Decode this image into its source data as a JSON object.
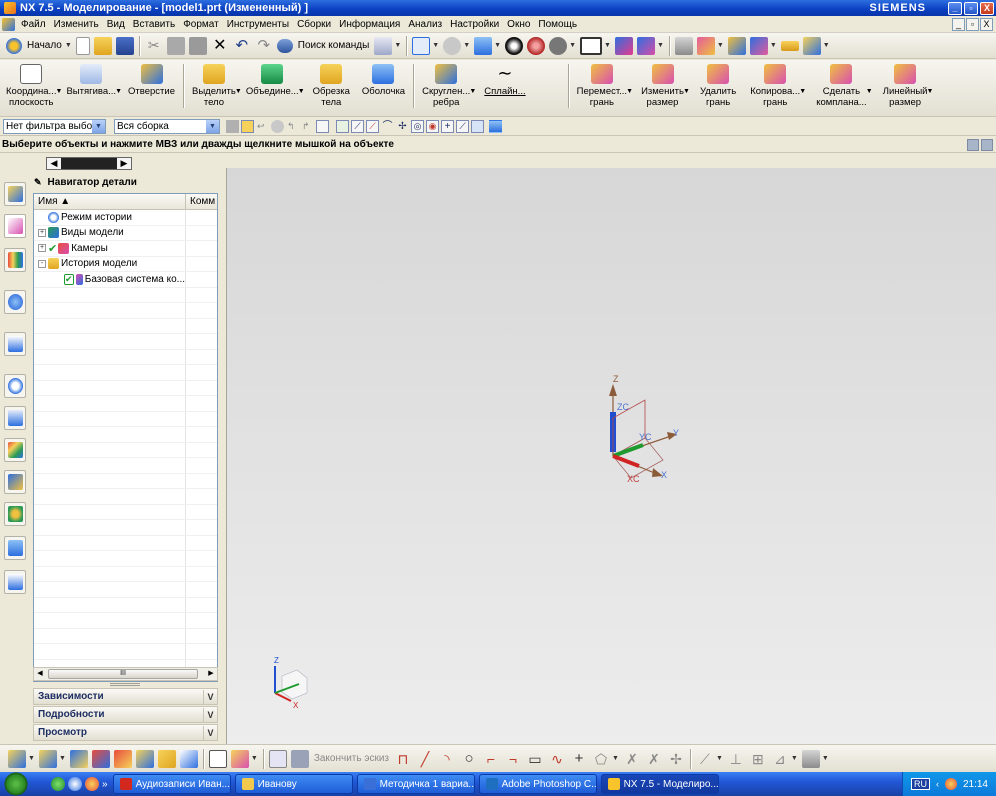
{
  "window": {
    "title": "NX 7.5 - Моделирование - [model1.prt (Измененный) ]",
    "brand": "SIEMENS",
    "controls": [
      "_",
      "▫",
      "X"
    ]
  },
  "menu": {
    "items": [
      "Файл",
      "Изменить",
      "Вид",
      "Вставить",
      "Формат",
      "Инструменты",
      "Сборки",
      "Информация",
      "Анализ",
      "Настройки",
      "Окно",
      "Помощь"
    ],
    "mdi_controls": [
      "_",
      "▫",
      "X"
    ]
  },
  "toolbar1": {
    "start_label": "Начало",
    "search_label": "Поиск команды"
  },
  "toolbar2": {
    "buttons": [
      {
        "label1": "Координа...",
        "label2": "плоскость",
        "color": "#E8E8E8"
      },
      {
        "label1": "Вытягива...",
        "label2": "",
        "color": "#C9D9F0"
      },
      {
        "label1": "Отверстие",
        "label2": "",
        "color": "#4D8FE0"
      },
      {
        "label1": "Выделить",
        "label2": "тело",
        "color": "#E8A53A"
      },
      {
        "label1": "Объедине...",
        "label2": "",
        "color": "#2C9A55"
      },
      {
        "label1": "Обрезка",
        "label2": "тела",
        "color": "#F0C040"
      },
      {
        "label1": "Оболочка",
        "label2": "",
        "color": "#4D8FE0"
      },
      {
        "label1": "Скруглен...",
        "label2": "ребра",
        "color": "#4D8FE0"
      },
      {
        "label1": "Сплайн...",
        "label2": "",
        "color": "#FFFFFF"
      },
      {
        "label1": "Перемест...",
        "label2": "грань",
        "color": "#D84FB0"
      },
      {
        "label1": "Изменить",
        "label2": "размер",
        "color": "#D84FB0"
      },
      {
        "label1": "Удалить",
        "label2": "грань",
        "color": "#D84FB0"
      },
      {
        "label1": "Копирова...",
        "label2": "грань",
        "color": "#D84FB0"
      },
      {
        "label1": "Сделать",
        "label2": "компланa...",
        "color": "#D84FB0"
      },
      {
        "label1": "Линейный",
        "label2": "размер",
        "color": "#D84FB0"
      }
    ]
  },
  "selection_bar": {
    "filter_value": "Нет фильтра выбо",
    "scope_value": "Вся сборка"
  },
  "cue_line": "Выберите объекты и нажмите МВЗ или дважды щелкните мышкой на объекте",
  "resource_bar": {
    "icons": [
      "assembly-navigator-icon",
      "part-navigator-icon",
      "reuse-library-icon",
      "help-icon",
      "web-icon",
      "history-icon",
      "system-materials-icon",
      "palette-icon",
      "process-studio-icon",
      "roles-icon",
      "system-scene-icon",
      "manufacturing-icon"
    ]
  },
  "navigator": {
    "title": "Навигатор детали",
    "columns": [
      "Имя",
      "Комм"
    ],
    "rows": [
      {
        "label": "Режим истории",
        "indent": 0,
        "expander": ""
      },
      {
        "label": "Виды модели",
        "indent": 0,
        "expander": "+"
      },
      {
        "label": "Камеры",
        "indent": 0,
        "expander": "+"
      },
      {
        "label": "История модели",
        "indent": 0,
        "expander": "-"
      },
      {
        "label": "Базовая система ко...",
        "indent": 1,
        "expander": ""
      }
    ],
    "scroll_center": "III",
    "panels": [
      "Зависимости",
      "Подробности",
      "Просмотр"
    ]
  },
  "viewport": {
    "axes": {
      "z": "Z",
      "zc": "ZC",
      "y": "Y",
      "yc": "YC",
      "x": "X",
      "xc": "XC"
    },
    "triad": {
      "z": "Z",
      "x": "X"
    }
  },
  "bottom_toolbar": {
    "finish_sketch": "Закончить эскиз"
  },
  "taskbar": {
    "tasks": [
      {
        "label": "Аудиозаписи Иван...",
        "color": "#D3281D"
      },
      {
        "label": "Иванову",
        "color": "#F2C94C"
      },
      {
        "label": "Методичка 1 вариа...",
        "color": "#3A6FD8"
      },
      {
        "label": "Adobe Photoshop C...",
        "color": "#1F6FC0"
      },
      {
        "label": "NX 7.5 - Моделиро...",
        "color": "#F9C32B"
      }
    ],
    "lang": "RU",
    "time": "21:14"
  }
}
